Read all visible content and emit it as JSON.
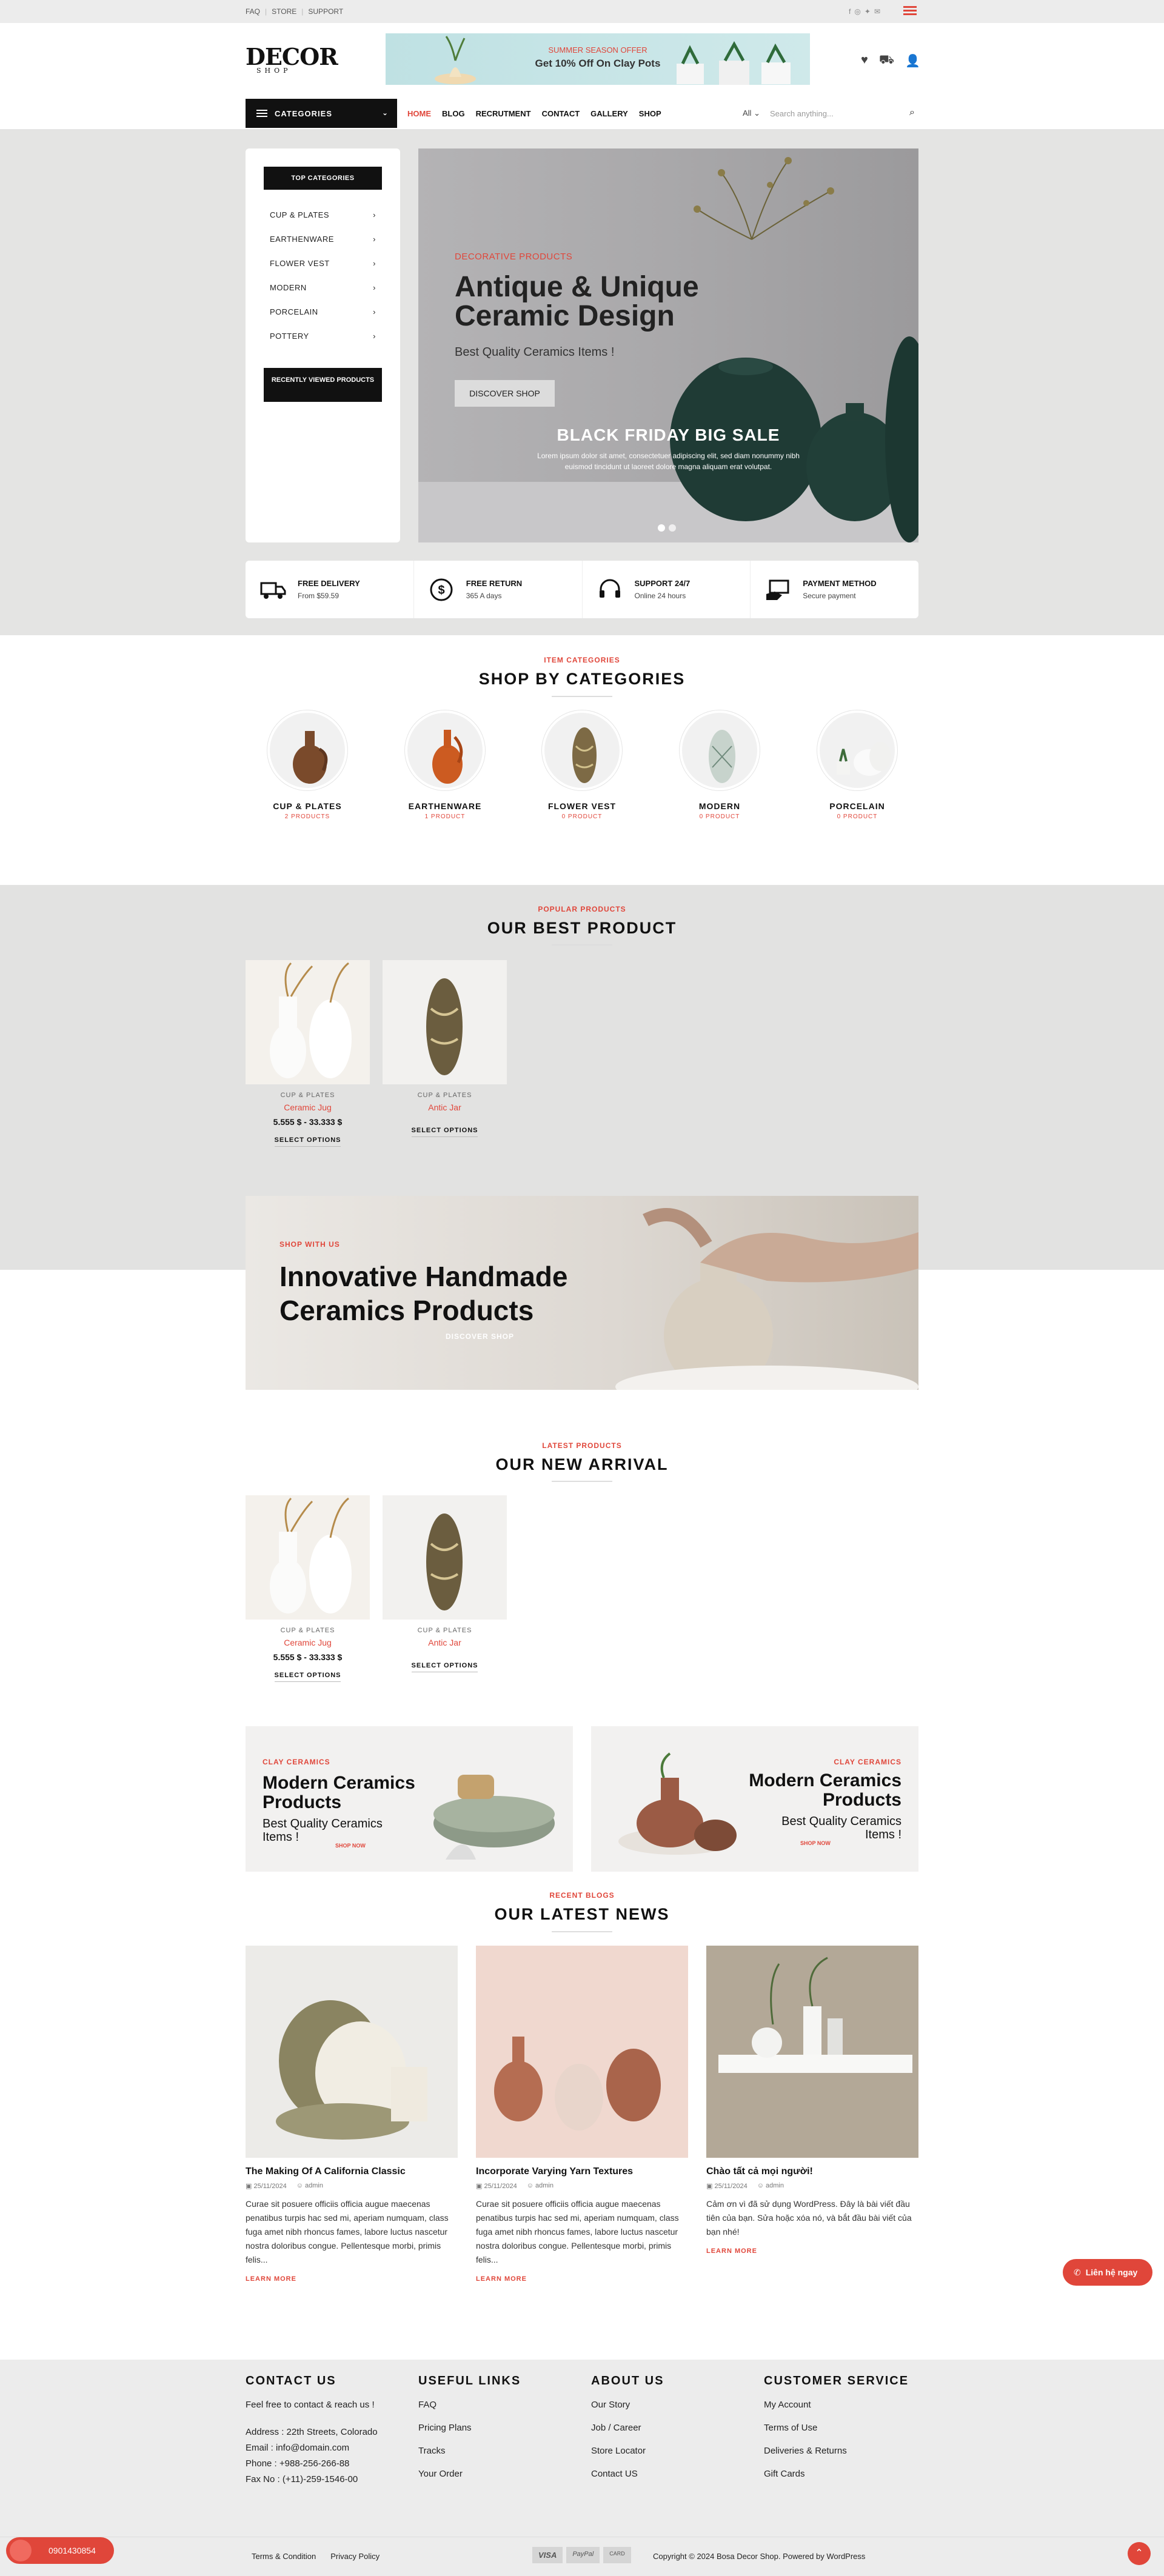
{
  "topbar": {
    "links": [
      "FAQ",
      "STORE",
      "SUPPORT"
    ]
  },
  "header": {
    "logo_main": "DECOR",
    "logo_sub": "SHOP",
    "promo_line1": "SUMMER SEASON OFFER",
    "promo_line2": "Get 10% Off On Clay Pots"
  },
  "nav": {
    "categories_label": "CATEGORIES",
    "items": [
      "HOME",
      "BLOG",
      "RECRUTMENT",
      "CONTACT",
      "GALLERY",
      "SHOP"
    ],
    "search_scope": "All",
    "search_placeholder": "Search anything..."
  },
  "sidebar": {
    "title": "TOP CATEGORIES",
    "items": [
      "CUP & PLATES",
      "EARTHENWARE",
      "FLOWER VEST",
      "MODERN",
      "PORCELAIN",
      "POTTERY"
    ],
    "recent_label": "RECENTLY VIEWED PRODUCTS"
  },
  "hero": {
    "subtitle": "DECORATIVE PRODUCTS",
    "title": "Antique & Unique Ceramic Design",
    "tagline": "Best Quality Ceramics Items !",
    "button": "DISCOVER SHOP",
    "sale": "BLACK FRIDAY BIG SALE",
    "lorem": "Lorem ipsum dolor sit amet, consectetuer adipiscing elit, sed diam nonummy nibh euismod tincidunt ut laoreet dolore magna aliquam erat volutpat.",
    "slides": 2
  },
  "features": [
    {
      "title": "FREE DELIVERY",
      "sub": "From $59.59",
      "icon": "truck-icon"
    },
    {
      "title": "FREE RETURN",
      "sub": "365 A days",
      "icon": "dollar-return-icon"
    },
    {
      "title": "SUPPORT 24/7",
      "sub": "Online 24 hours",
      "icon": "headset-icon"
    },
    {
      "title": "PAYMENT METHOD",
      "sub": "Secure payment",
      "icon": "payment-icon"
    }
  ],
  "categories_section": {
    "subtitle": "ITEM CATEGORIES",
    "title": "SHOP BY CATEGORIES",
    "items": [
      {
        "name": "CUP & PLATES",
        "count": "2 PRODUCTS"
      },
      {
        "name": "EARTHENWARE",
        "count": "1 PRODUCT"
      },
      {
        "name": "FLOWER VEST",
        "count": "0 PRODUCT"
      },
      {
        "name": "MODERN",
        "count": "0 PRODUCT"
      },
      {
        "name": "PORCELAIN",
        "count": "0 PRODUCT"
      }
    ]
  },
  "best_section": {
    "subtitle": "POPULAR PRODUCTS",
    "title": "OUR BEST PRODUCT",
    "products": [
      {
        "category": "CUP & PLATES",
        "name": "Ceramic Jug",
        "price": "5.555 $ - 33.333 $",
        "action": "SELECT OPTIONS"
      },
      {
        "category": "CUP & PLATES",
        "name": "Antic Jar",
        "price": "",
        "action": "SELECT OPTIONS"
      }
    ]
  },
  "banner": {
    "subtitle": "SHOP WITH US",
    "title": "Innovative Handmade Ceramics Products",
    "button": "DISCOVER SHOP"
  },
  "new_section": {
    "subtitle": "LATEST PRODUCTS",
    "title": "OUR NEW ARRIVAL",
    "products": [
      {
        "category": "CUP & PLATES",
        "name": "Ceramic Jug",
        "price": "5.555 $ - 33.333 $",
        "action": "SELECT OPTIONS"
      },
      {
        "category": "CUP & PLATES",
        "name": "Antic Jar",
        "price": "",
        "action": "SELECT OPTIONS"
      }
    ]
  },
  "promos": [
    {
      "subtitle": "CLAY CERAMICS",
      "title": "Modern Ceramics Products",
      "tagline": "Best Quality Ceramics Items !",
      "button": "SHOP NOW"
    },
    {
      "subtitle": "CLAY CERAMICS",
      "title": "Modern Ceramics Products",
      "tagline": "Best Quality Ceramics Items !",
      "button": "SHOP NOW"
    }
  ],
  "news_section": {
    "subtitle": "RECENT BLOGS",
    "title": "OUR LATEST NEWS",
    "posts": [
      {
        "title": "The Making Of A California Classic",
        "date": "25/11/2024",
        "author": "admin",
        "excerpt": "Curae sit posuere officiis officia augue maecenas penatibus turpis hac sed mi, aperiam numquam, class fuga amet nibh rhoncus fames, labore luctus nascetur nostra doloribus congue. Pellentesque morbi, primis felis...",
        "more": "LEARN MORE"
      },
      {
        "title": "Incorporate Varying Yarn Textures",
        "date": "25/11/2024",
        "author": "admin",
        "excerpt": "Curae sit posuere officiis officia augue maecenas penatibus turpis hac sed mi, aperiam numquam, class fuga amet nibh rhoncus fames, labore luctus nascetur nostra doloribus congue. Pellentesque morbi, primis felis...",
        "more": "LEARN MORE"
      },
      {
        "title": "Chào tất cả mọi người!",
        "date": "25/11/2024",
        "author": "admin",
        "excerpt": "Cảm ơn vì đã sử dụng WordPress. Đây là bài viết đầu tiên của bạn. Sửa hoặc xóa nó, và bắt đầu bài viết của bạn nhé!",
        "more": "LEARN MORE"
      }
    ]
  },
  "contact_button": "Liên hệ ngay",
  "footer": {
    "contact": {
      "title": "CONTACT US",
      "intro": "Feel free to contact & reach us !",
      "lines": [
        "Address : 22th Streets, Colorado",
        "Email : info@domain.com",
        "Phone : +988-256-266-88",
        "Fax No : (+11)-259-1546-00"
      ]
    },
    "useful": {
      "title": "USEFUL LINKS",
      "links": [
        "FAQ",
        "Pricing Plans",
        "Tracks",
        "Your Order"
      ]
    },
    "about": {
      "title": "ABOUT US",
      "links": [
        "Our Story",
        "Job / Career",
        "Store Locator",
        "Contact US"
      ]
    },
    "service": {
      "title": "CUSTOMER SERVICE",
      "links": [
        "My Account",
        "Terms of Use",
        "Deliveries & Returns",
        "Gift Cards"
      ]
    },
    "bottom_links": [
      "Terms & Condition",
      "Privacy Policy"
    ],
    "payments": [
      "VISA",
      "PayPal",
      "CARD"
    ],
    "copyright": "Copyright © 2024 Bosa Decor Shop. Powered by WordPress",
    "phone": "0901430854"
  },
  "colors": {
    "accent": "#e0463a",
    "dark": "#111111",
    "grey_band": "#e4e4e3"
  }
}
